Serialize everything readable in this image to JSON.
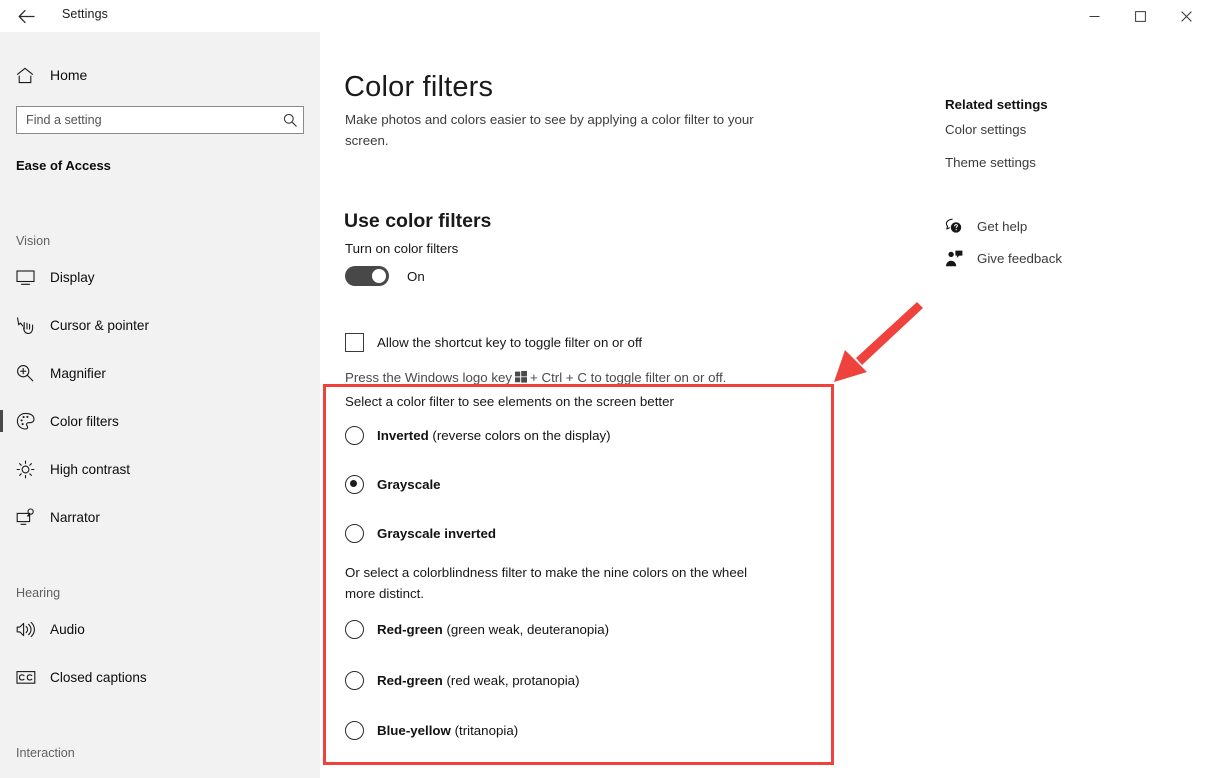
{
  "window": {
    "title": "Settings",
    "back_icon": "back-arrow-icon",
    "controls": {
      "minimize": "minimize-icon",
      "maximize": "maximize-icon",
      "close": "close-icon"
    }
  },
  "sidebar": {
    "home": {
      "label": "Home",
      "icon": "home-icon"
    },
    "search": {
      "placeholder": "Find a setting",
      "value": "",
      "icon": "search-icon"
    },
    "category": "Ease of Access",
    "groups": [
      {
        "label": "Vision"
      },
      {
        "label": "Hearing"
      },
      {
        "label": "Interaction"
      }
    ],
    "items": [
      {
        "label": "Display",
        "icon": "monitor-icon",
        "selected": false
      },
      {
        "label": "Cursor & pointer",
        "icon": "cursor-pointer-icon",
        "selected": false
      },
      {
        "label": "Magnifier",
        "icon": "magnifier-icon",
        "selected": false
      },
      {
        "label": "Color filters",
        "icon": "palette-icon",
        "selected": true
      },
      {
        "label": "High contrast",
        "icon": "sun-icon",
        "selected": false
      },
      {
        "label": "Narrator",
        "icon": "narrator-icon",
        "selected": false
      },
      {
        "label": "Audio",
        "icon": "speaker-icon",
        "selected": false
      },
      {
        "label": "Closed captions",
        "icon": "closed-captions-icon",
        "selected": false
      }
    ]
  },
  "main": {
    "title": "Color filters",
    "description": "Make photos and colors easier to see by applying a color filter to your screen.",
    "section_heading": "Use color filters",
    "toggle": {
      "caption": "Turn on color filters",
      "state_label": "On",
      "on": true
    },
    "shortcut": {
      "checkbox_label": "Allow the shortcut key to toggle filter on or off",
      "checked": false,
      "hint_prefix": "Press the Windows logo key",
      "hint_suffix": "+ Ctrl + C to toggle filter on or off.",
      "key_icon": "windows-logo-icon"
    },
    "filters": {
      "intro": "Select a color filter to see elements on the screen better",
      "colorblind_intro": "Or select a colorblindness filter to make the nine colors on the wheel more distinct.",
      "options": [
        {
          "strong": "Inverted",
          "rest": " (reverse colors on the display)",
          "selected": false
        },
        {
          "strong": "Grayscale",
          "rest": "",
          "selected": true
        },
        {
          "strong": "Grayscale inverted",
          "rest": "",
          "selected": false
        },
        {
          "strong": "Red-green",
          "rest": " (green weak, deuteranopia)",
          "selected": false
        },
        {
          "strong": "Red-green",
          "rest": " (red weak, protanopia)",
          "selected": false
        },
        {
          "strong": "Blue-yellow",
          "rest": " (tritanopia)",
          "selected": false
        }
      ]
    }
  },
  "right_rail": {
    "related_heading": "Related settings",
    "links": [
      {
        "label": "Color settings"
      },
      {
        "label": "Theme settings"
      }
    ],
    "actions": [
      {
        "label": "Get help",
        "icon": "help-question-bubble-icon"
      },
      {
        "label": "Give feedback",
        "icon": "give-feedback-icon"
      }
    ]
  },
  "annotations": {
    "highlight_box_color": "#f0423c",
    "arrow_color": "#f0423c"
  }
}
